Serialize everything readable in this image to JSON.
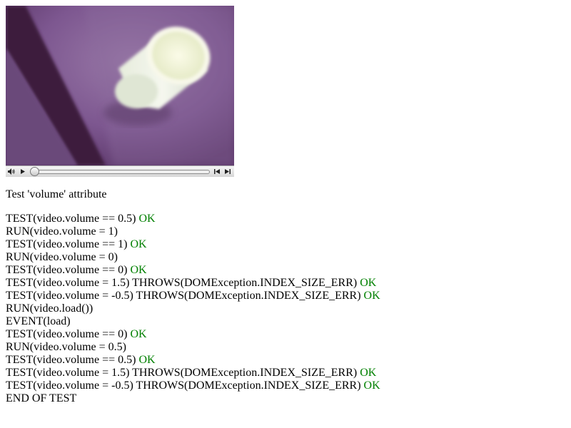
{
  "page": {
    "title": "Test 'volume' attribute"
  },
  "colors": {
    "ok": "#008000",
    "text": "#000000",
    "video_bg": "#7a4f88"
  },
  "video": {
    "controls": {
      "volume_icon": "speaker-icon",
      "play_icon": "play-icon",
      "rewind_icon": "rewind-icon",
      "forward_icon": "fast-forward-icon",
      "progress": 0
    }
  },
  "log": [
    {
      "text": "TEST(video.volume == 0.5) ",
      "status": "OK"
    },
    {
      "text": "RUN(video.volume = 1)",
      "status": ""
    },
    {
      "text": "TEST(video.volume == 1) ",
      "status": "OK"
    },
    {
      "text": "RUN(video.volume = 0)",
      "status": ""
    },
    {
      "text": "TEST(video.volume == 0) ",
      "status": "OK"
    },
    {
      "text": "TEST(video.volume = 1.5) THROWS(DOMException.INDEX_SIZE_ERR) ",
      "status": "OK"
    },
    {
      "text": "TEST(video.volume = -0.5) THROWS(DOMException.INDEX_SIZE_ERR) ",
      "status": "OK"
    },
    {
      "text": "RUN(video.load())",
      "status": ""
    },
    {
      "text": "EVENT(load)",
      "status": ""
    },
    {
      "text": "TEST(video.volume == 0) ",
      "status": "OK"
    },
    {
      "text": "RUN(video.volume = 0.5)",
      "status": ""
    },
    {
      "text": "TEST(video.volume == 0.5) ",
      "status": "OK"
    },
    {
      "text": "TEST(video.volume = 1.5) THROWS(DOMException.INDEX_SIZE_ERR) ",
      "status": "OK"
    },
    {
      "text": "TEST(video.volume = -0.5) THROWS(DOMException.INDEX_SIZE_ERR) ",
      "status": "OK"
    },
    {
      "text": "END OF TEST",
      "status": ""
    }
  ]
}
